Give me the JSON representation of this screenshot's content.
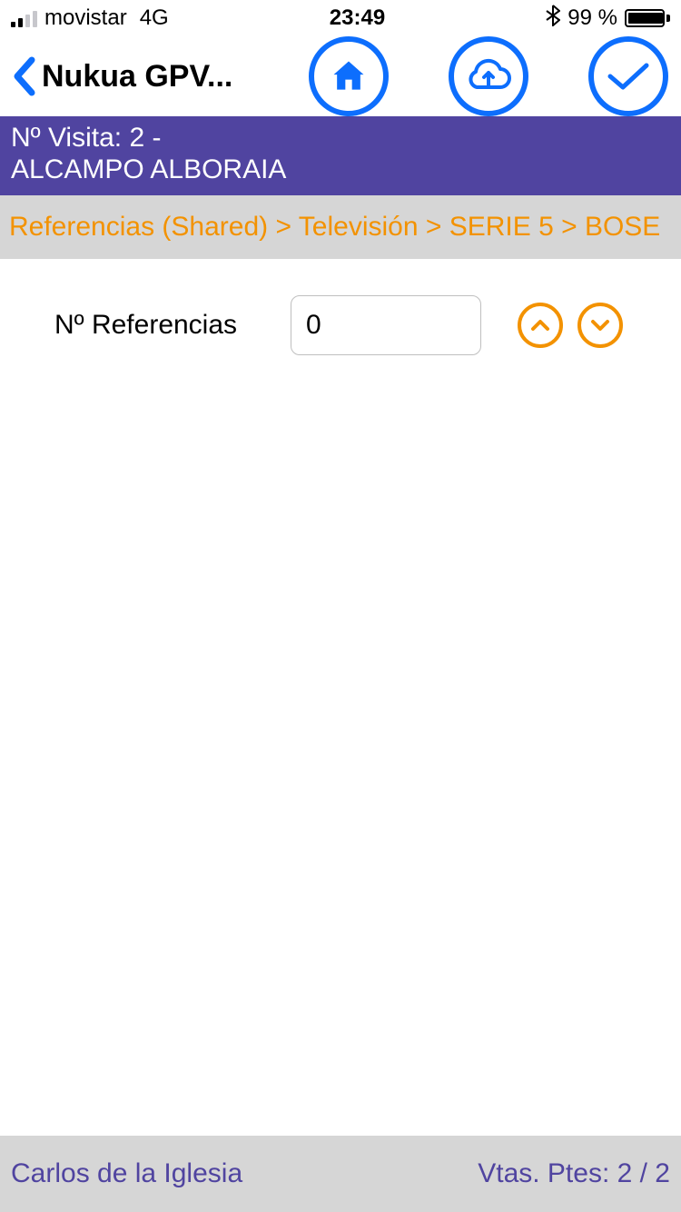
{
  "status": {
    "carrier": "movistar",
    "network": "4G",
    "time": "23:49",
    "battery_pct": "99 %"
  },
  "nav": {
    "title": "Nukua GPV..."
  },
  "banner": {
    "line1": "Nº Visita: 2 -",
    "line2": "ALCAMPO ALBORAIA"
  },
  "breadcrumb": {
    "text": "Referencias (Shared) > Televisión > SERIE 5 > BOSE"
  },
  "form": {
    "label": "Nº Referencias",
    "value": "0"
  },
  "footer": {
    "user": "Carlos de la Iglesia",
    "pending": "Vtas. Ptes: 2 / 2"
  }
}
